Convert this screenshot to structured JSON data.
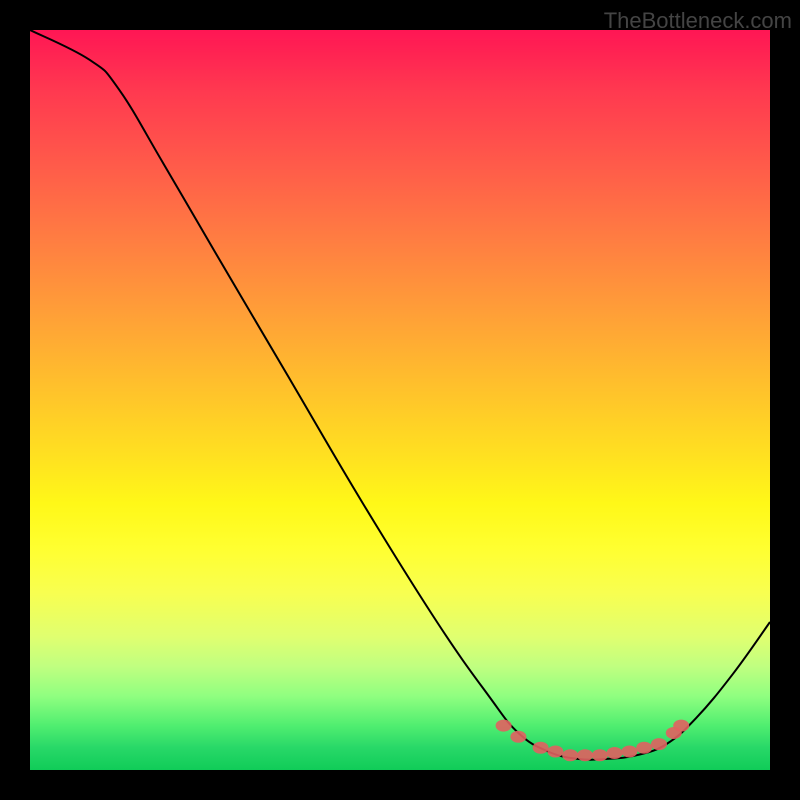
{
  "watermark": "TheBottleneck.com",
  "chart_data": {
    "type": "line",
    "title": "",
    "xlabel": "",
    "ylabel": "",
    "xlim": [
      0,
      100
    ],
    "ylim": [
      0,
      100
    ],
    "curve_points": [
      {
        "x": 0,
        "y": 100
      },
      {
        "x": 8,
        "y": 96
      },
      {
        "x": 12,
        "y": 92
      },
      {
        "x": 18,
        "y": 82
      },
      {
        "x": 25,
        "y": 70
      },
      {
        "x": 35,
        "y": 53
      },
      {
        "x": 45,
        "y": 36
      },
      {
        "x": 55,
        "y": 20
      },
      {
        "x": 62,
        "y": 10
      },
      {
        "x": 66,
        "y": 5
      },
      {
        "x": 70,
        "y": 2.5
      },
      {
        "x": 74,
        "y": 1.5
      },
      {
        "x": 78,
        "y": 1.5
      },
      {
        "x": 82,
        "y": 2
      },
      {
        "x": 86,
        "y": 3.5
      },
      {
        "x": 90,
        "y": 7
      },
      {
        "x": 95,
        "y": 13
      },
      {
        "x": 100,
        "y": 20
      }
    ],
    "series": [
      {
        "name": "scatter-dots",
        "points": [
          {
            "x": 64,
            "y": 6
          },
          {
            "x": 66,
            "y": 4.5
          },
          {
            "x": 69,
            "y": 3
          },
          {
            "x": 71,
            "y": 2.5
          },
          {
            "x": 73,
            "y": 2
          },
          {
            "x": 75,
            "y": 2
          },
          {
            "x": 77,
            "y": 2
          },
          {
            "x": 79,
            "y": 2.3
          },
          {
            "x": 81,
            "y": 2.5
          },
          {
            "x": 83,
            "y": 3
          },
          {
            "x": 85,
            "y": 3.5
          },
          {
            "x": 87,
            "y": 5
          },
          {
            "x": 88,
            "y": 6
          }
        ]
      }
    ]
  }
}
